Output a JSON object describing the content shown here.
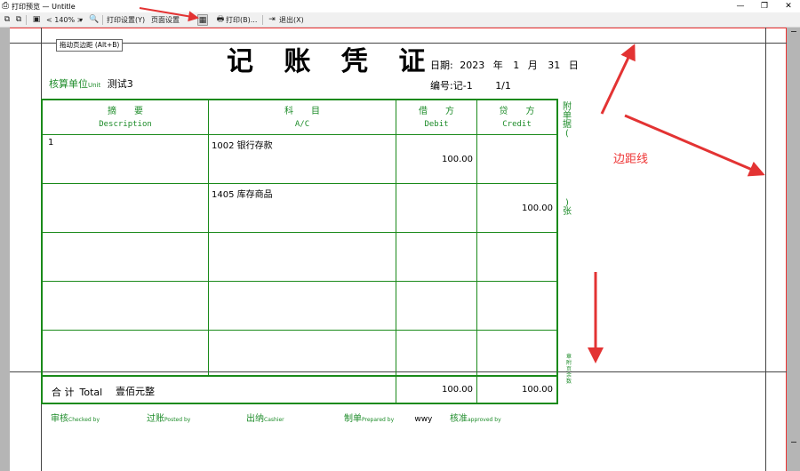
{
  "window": {
    "title": "打印预览 — Untitle",
    "min_glyph": "—",
    "max_glyph": "❐",
    "close_glyph": "✕"
  },
  "toolbar": {
    "zoom": "< 140% >",
    "print_settings": "打印设置(Y)",
    "page_settings": "页面设置",
    "print": "打印(B)...",
    "exit": "退出(X)"
  },
  "tooltip": "拖动页边距 (Alt+B)",
  "voucher": {
    "title": "记 账 凭 证",
    "date_label": "日期:",
    "year": "2023",
    "year_unit": "年",
    "month": "1",
    "month_unit": "月",
    "day": "31",
    "day_unit": "日",
    "number_label": "编号:",
    "number": "记-1",
    "page": "1/1",
    "unit_label": "核算单位",
    "unit_label_en": "Unit",
    "unit_value": "测试3"
  },
  "table": {
    "headers": [
      {
        "cn": "摘　　要",
        "en": "Description"
      },
      {
        "cn": "科　　目",
        "en": "A/C"
      },
      {
        "cn": "借　　方",
        "en": "Debit"
      },
      {
        "cn": "贷　　方",
        "en": "Credit"
      }
    ],
    "rows": [
      {
        "description": "1",
        "account": "1002 银行存款",
        "debit": "100.00",
        "credit": ""
      },
      {
        "description": "",
        "account": "1405 库存商品",
        "debit": "",
        "credit": "100.00"
      },
      {
        "description": "",
        "account": "",
        "debit": "",
        "credit": ""
      },
      {
        "description": "",
        "account": "",
        "debit": "",
        "credit": ""
      },
      {
        "description": "",
        "account": "",
        "debit": "",
        "credit": ""
      }
    ],
    "total_label": "合 计",
    "total_label_en": "Total",
    "total_words": "壹佰元整",
    "total_debit": "100.00",
    "total_credit": "100.00"
  },
  "side": {
    "attach_top": "附单据(",
    "attach_bottom": ")张",
    "bottom_text": "章附页余数"
  },
  "signatures": {
    "checked": "审核",
    "checked_en": "Checked by",
    "posted": "过账",
    "posted_en": "Posted by",
    "cashier": "出纳",
    "cashier_en": "Cashier",
    "prepared": "制单",
    "prepared_en": "Prepared by",
    "prepared_value": "wwy",
    "approved": "核准",
    "approved_en": "approved by"
  },
  "annotation": "边距线",
  "colors": {
    "green": "#1a8a1a",
    "red": "#e33333"
  }
}
